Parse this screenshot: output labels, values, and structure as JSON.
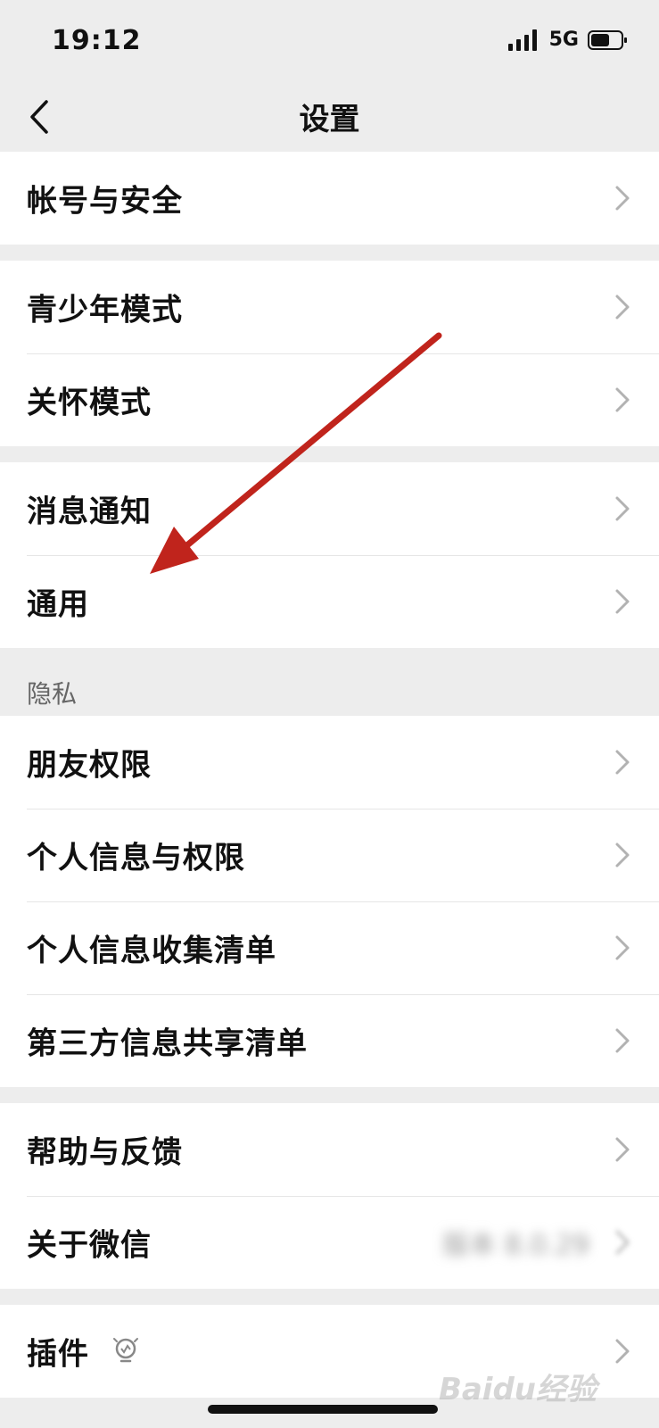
{
  "status_bar": {
    "time": "19:12",
    "network": "5G"
  },
  "nav": {
    "title": "设置",
    "back_icon": "chevron-left-icon"
  },
  "groups": [
    {
      "items": [
        {
          "label": "帐号与安全"
        }
      ]
    },
    {
      "items": [
        {
          "label": "青少年模式"
        },
        {
          "label": "关怀模式"
        }
      ]
    },
    {
      "items": [
        {
          "label": "消息通知"
        },
        {
          "label": "通用"
        }
      ]
    }
  ],
  "privacy": {
    "header": "隐私",
    "items": [
      {
        "label": "朋友权限"
      },
      {
        "label": "个人信息与权限"
      },
      {
        "label": "个人信息收集清单"
      },
      {
        "label": "第三方信息共享清单"
      }
    ]
  },
  "support": {
    "items": [
      {
        "label": "帮助与反馈"
      },
      {
        "label": "关于微信",
        "value": "版本 8.0.29"
      }
    ]
  },
  "plugins": {
    "label": "插件"
  },
  "watermark": "Baidu经验",
  "colors": {
    "background": "#ededed",
    "cell": "#ffffff",
    "arrow": "#c0241c"
  }
}
